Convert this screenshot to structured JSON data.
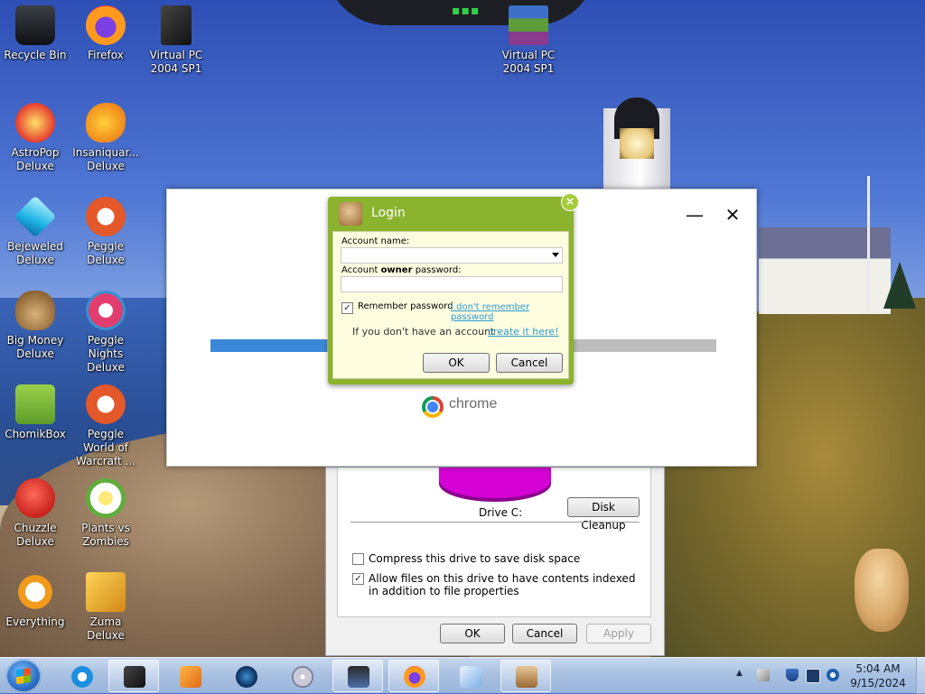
{
  "desktop": {
    "icons": [
      {
        "label": "Recycle Bin"
      },
      {
        "label": "Firefox"
      },
      {
        "label": "Virtual PC 2004 SP1"
      },
      {
        "label": "Virtual PC 2004 SP1"
      },
      {
        "label": "AstroPop Deluxe"
      },
      {
        "label": "Insaniquar... Deluxe"
      },
      {
        "label": "Bejeweled Deluxe"
      },
      {
        "label": "Peggle Deluxe"
      },
      {
        "label": "Big Money Deluxe"
      },
      {
        "label": "Peggle Nights Deluxe"
      },
      {
        "label": "ChomikBox"
      },
      {
        "label": "Peggle World of Warcraft ..."
      },
      {
        "label": "Chuzzle Deluxe"
      },
      {
        "label": "Plants vs Zombies"
      },
      {
        "label": "Everything"
      },
      {
        "label": "Zuma Deluxe"
      }
    ]
  },
  "chrome_installer": {
    "min_glyph": "—",
    "close_glyph": "✕",
    "progress": 0.23,
    "brand": "chrome"
  },
  "properties": {
    "drive_label": "Drive C:",
    "disk_cleanup": "Disk Cleanup",
    "compress_label": "Compress this drive to save disk space",
    "compress_checked": false,
    "index_label": "Allow files on this drive to have contents indexed in addition to file properties",
    "index_checked": true,
    "ok": "OK",
    "cancel": "Cancel",
    "apply": "Apply",
    "pie_color": "#d400d4"
  },
  "login": {
    "title": "Login",
    "close_glyph": "×",
    "account_name_label": "Account name:",
    "account_name_value": "",
    "password_label_prefix": "Account ",
    "password_label_bold": "owner",
    "password_label_suffix": " password:",
    "password_value": "",
    "remember_label": "Remember password",
    "remember_checked": true,
    "forgot_link": "I don't remember password",
    "no_account_text": "If you don't have an account -",
    "create_link": "create it here!",
    "ok": "OK",
    "cancel": "Cancel",
    "accent_color": "#8bb32e"
  },
  "taskbar": {
    "clock_time": "5:04 AM",
    "clock_date": "9/15/2024",
    "tray_chevron": "▲"
  }
}
